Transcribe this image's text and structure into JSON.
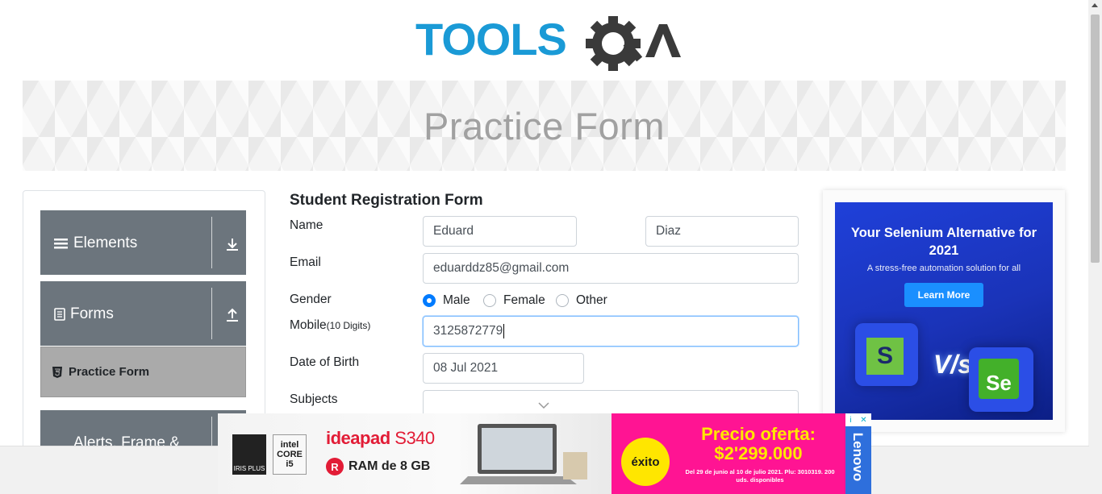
{
  "logo": {
    "text_tools": "TOOLS",
    "text_qa": "QA"
  },
  "banner": {
    "title": "Practice Form"
  },
  "sidebar": {
    "groups": [
      {
        "label": "Elements",
        "icon": "hamburger-icon",
        "toggle_icon": "arrow-down-icon"
      },
      {
        "label": "Forms",
        "icon": "document-icon",
        "toggle_icon": "arrow-up-icon"
      },
      {
        "label": "Alerts, Frame & Windows",
        "icon": "window-icon"
      }
    ],
    "active_item": {
      "label": "Practice Form",
      "icon": "html5-icon"
    }
  },
  "form": {
    "title": "Student Registration Form",
    "name_label": "Name",
    "first_name": "Eduard",
    "last_name": "Diaz",
    "email_label": "Email",
    "email_value": "eduarddz85@gmail.com",
    "gender_label": "Gender",
    "gender_options": [
      "Male",
      "Female",
      "Other"
    ],
    "gender_selected": "Male",
    "mobile_label": "Mobile",
    "mobile_hint": "(10 Digits)",
    "mobile_value": "3125872779",
    "dob_label": "Date of Birth",
    "dob_value": "08 Jul 2021",
    "subjects_label": "Subjects"
  },
  "ad_right": {
    "headline": "Your Selenium Alternative for 2021",
    "subtext": "A stress-free automation solution for all",
    "button": "Learn More",
    "vs_text": "V/s",
    "tile_left": "S",
    "tile_right": "Se",
    "accent": "#1a8fff",
    "background": "#1f40d9"
  },
  "ad_bottom": {
    "chip_left": "IRIS PLUS",
    "chip_intel_top": "intel",
    "chip_intel_bottom": "CORE i5",
    "brand": "ideapad",
    "model": "S340",
    "ram_icon": "R",
    "ram": "RAM de 8 GB",
    "store": "éxito",
    "offer_line1": "Precio oferta:",
    "offer_line2": "$2'299.000",
    "fine_print": "Del 29 de junio al 10 de julio 2021. Plu: 3010319. 200 uds. disponibles",
    "lenovo": "Lenovo",
    "close": "✕",
    "info": "i",
    "pink": "#ff1493",
    "yellow": "#ffe600"
  }
}
